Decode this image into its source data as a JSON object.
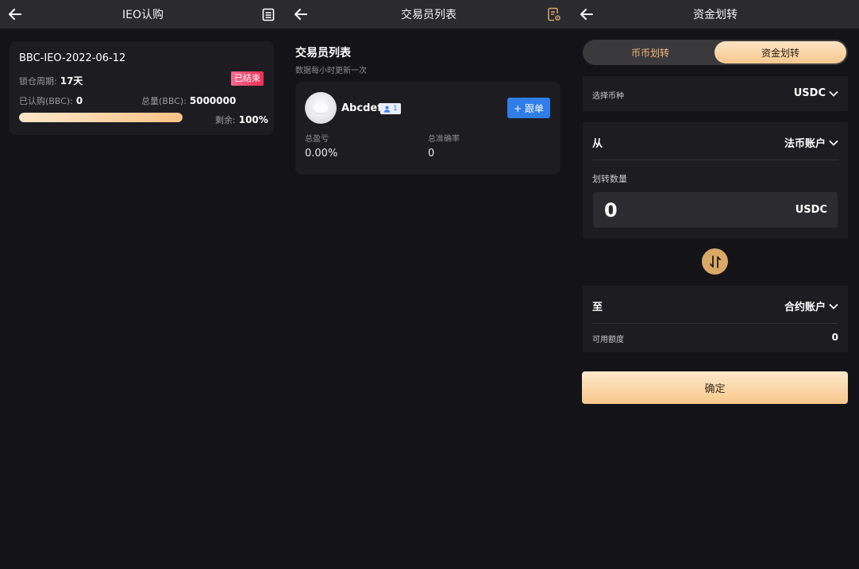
{
  "ieo_screen": {
    "title": "IEO认购",
    "card": {
      "name": "BBC-IEO-2022-06-12",
      "lock_label": "锁仓周期:",
      "lock_value": "17天",
      "status": "已结束",
      "subscribed_label": "已认购(BBC):",
      "subscribed_value": "0",
      "total_label": "总量(BBC):",
      "total_value": "5000000",
      "remaining_label": "剩余:",
      "remaining_value": "100%",
      "progress_fraction": 1.0
    }
  },
  "trader_screen": {
    "title": "交易员列表",
    "section_title": "交易员列表",
    "section_subtitle": "数据每小时更新一次",
    "trader": {
      "name": "Abcdef",
      "followers": "1",
      "follow_label": "+ 跟单",
      "pnl_label": "总盈亏",
      "pnl_value": "0.00%",
      "accuracy_label": "总准确率",
      "accuracy_value": "0"
    }
  },
  "transfer_screen": {
    "title": "资金划转",
    "tabs": [
      "币币划转",
      "资金划转"
    ],
    "active_tab": 1,
    "coin_label": "选择币种",
    "coin_value": "USDC",
    "from_label": "从",
    "from_value": "法币账户",
    "amount_label": "划转数量",
    "amount_value": "0",
    "amount_unit": "USDC",
    "to_label": "至",
    "to_value": "合约账户",
    "available_label": "可用额度",
    "available_value": "0",
    "confirm_label": "确定"
  },
  "colors": {
    "background": "#141418",
    "header": "#2b2b2f",
    "card": "#1d1d21",
    "accent_gold": "#f8c88c",
    "follow_blue": "#2f7de9",
    "status_red": "#ee2f55"
  },
  "icons": [
    "back-arrow-icon",
    "record-list-icon",
    "document-gear-icon",
    "chevron-down-icon",
    "swap-arrows-icon",
    "user-icon"
  ]
}
